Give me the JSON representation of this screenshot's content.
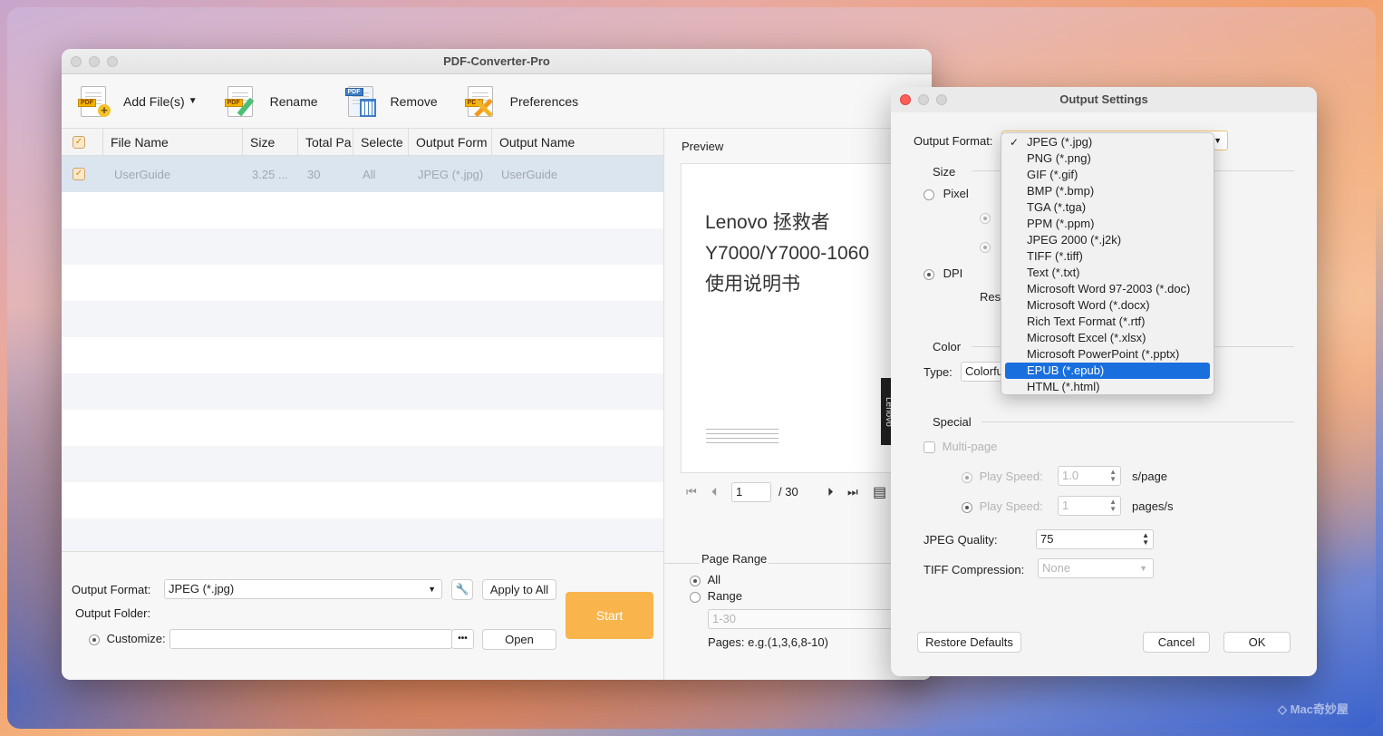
{
  "main_window": {
    "title": "PDF-Converter-Pro",
    "toolbar": {
      "add_files": "Add File(s)",
      "rename": "Rename",
      "remove": "Remove",
      "preferences": "Preferences"
    },
    "columns": [
      "File Name",
      "Size",
      "Total Pa",
      "Selecte",
      "Output Form",
      "Output Name"
    ],
    "rows": [
      {
        "file_name": "UserGuide",
        "size": "3.25 ...",
        "total_pages": "30",
        "selected": "All",
        "output_format": "JPEG (*.jpg)",
        "output_name": "UserGuide"
      }
    ],
    "bottom": {
      "output_format_label": "Output Format:",
      "output_format_value": "JPEG (*.jpg)",
      "apply_to_all": "Apply to All",
      "output_folder_label": "Output Folder:",
      "customize_label": "Customize:",
      "customize_value": "",
      "browse": "•••",
      "open": "Open",
      "start": "Start"
    },
    "preview": {
      "label": "Preview",
      "doc_line1": "Lenovo 拯救者",
      "doc_line2": "Y7000/Y7000-1060",
      "doc_line3": "使用说明书",
      "doc_side_brand": "Lenovo",
      "current_page": "1",
      "total_pages": "/ 30",
      "page_range_label": "Page Range",
      "all_label": "All",
      "range_label": "Range",
      "range_placeholder": "1-30",
      "pages_hint": "Pages: e.g.(1,3,6,8-10)"
    }
  },
  "dialog": {
    "title": "Output Settings",
    "output_format_label": "Output Format:",
    "size_label": "Size",
    "pixel_label": "Pixel",
    "dpi_label": "DPI",
    "resolution_partial": "Res",
    "color_label": "Color",
    "type_label": "Type:",
    "type_value": "Colorfu",
    "special_label": "Special",
    "multi_page": "Multi-page",
    "play_speed_label": "Play Speed:",
    "play_speed_1": "1.0",
    "play_speed_1_unit": "s/page",
    "play_speed_2": "1",
    "play_speed_2_unit": "pages/s",
    "jpeg_quality_label": "JPEG Quality:",
    "jpeg_quality_value": "75",
    "tiff_label": "TIFF Compression:",
    "tiff_value": "None",
    "restore_defaults": "Restore Defaults",
    "cancel": "Cancel",
    "ok": "OK",
    "format_options": [
      "JPEG (*.jpg)",
      "PNG (*.png)",
      "GIF (*.gif)",
      "BMP (*.bmp)",
      "TGA (*.tga)",
      "PPM (*.ppm)",
      "JPEG 2000 (*.j2k)",
      "TIFF (*.tiff)",
      "Text (*.txt)",
      "Microsoft Word 97-2003 (*.doc)",
      "Microsoft Word (*.docx)",
      "Rich Text Format (*.rtf)",
      "Microsoft Excel (*.xlsx)",
      "Microsoft PowerPoint (*.pptx)",
      "EPUB (*.epub)",
      "HTML (*.html)"
    ],
    "checked_option": "JPEG (*.jpg)",
    "highlighted_option": "EPUB (*.epub)"
  },
  "watermark": "Mac奇妙屋",
  "colors": {
    "start_button": "#f9b54c",
    "highlight": "#1a6fdf",
    "close_red": "#ff5f57"
  }
}
